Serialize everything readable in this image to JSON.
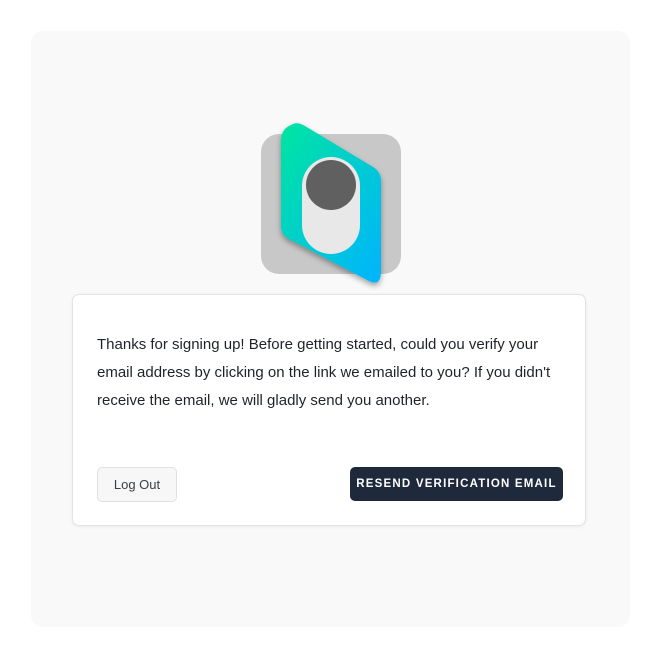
{
  "app": {
    "logo_icon": "toggle-switch-logo-icon",
    "colors": {
      "page_background": "#f9f9f9",
      "card_background": "#ffffff",
      "primary_button": "#1e293b",
      "logo_gradient_start": "#00e5a0",
      "logo_gradient_end": "#00b4ff"
    }
  },
  "verification": {
    "message": "Thanks for signing up! Before getting started, could you verify your email address by clicking on the link we emailed to you? If you didn't receive the email, we will gladly send you another.",
    "logout_label": "Log Out",
    "resend_label": "RESEND VERIFICATION EMAIL"
  }
}
